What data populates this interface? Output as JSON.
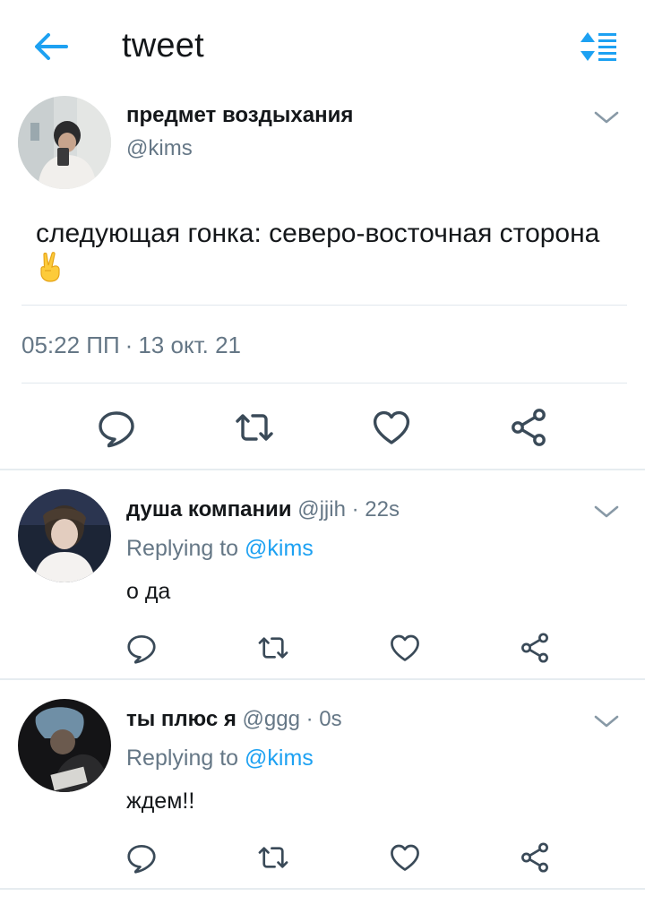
{
  "header": {
    "title": "tweet",
    "back_icon": "arrow-left-icon",
    "sort_icon": "sort-list-icon",
    "accent": "#1da1f2"
  },
  "main_tweet": {
    "display_name": "предмет воздыхания",
    "handle": "@kims",
    "text": "следующая гонка: северо-восточная сторона",
    "emoji": "victory-hand-emoji",
    "time": "05:22 ПП",
    "separator": "·",
    "date": "13 окт. 21",
    "actions": [
      "reply-icon",
      "retweet-icon",
      "like-icon",
      "share-icon"
    ]
  },
  "replies": [
    {
      "display_name": "душа компании",
      "handle": "@jjih",
      "age": "· 22s",
      "replying_prefix": "Replying to",
      "replying_to": "@kims",
      "text": "о да"
    },
    {
      "display_name": "ты плюс я",
      "handle": "@ggg",
      "age": "· 0s",
      "replying_prefix": "Replying to",
      "replying_to": "@kims",
      "text": "ждем!!"
    }
  ],
  "colors": {
    "text": "#14171a",
    "secondary": "#657786",
    "link": "#1da1f2",
    "divider": "#e1e8ed"
  }
}
